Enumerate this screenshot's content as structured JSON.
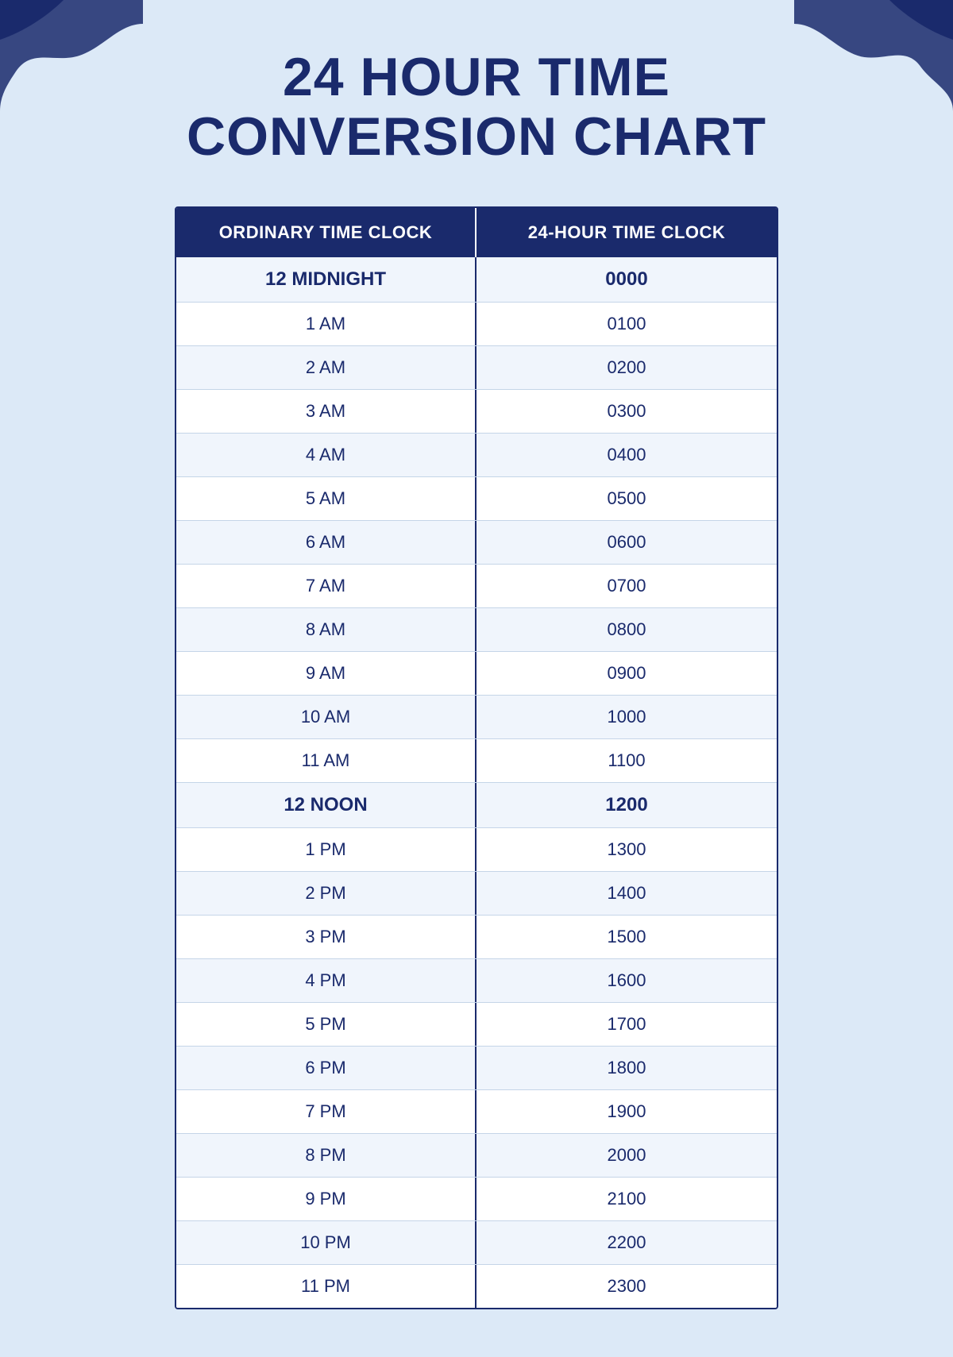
{
  "page": {
    "background_color": "#dce9f7",
    "title_line1": "24 HOUR TIME",
    "title_line2": "CONVERSION CHART"
  },
  "table": {
    "header": {
      "col1": "ORDINARY TIME CLOCK",
      "col2": "24-HOUR TIME CLOCK"
    },
    "rows": [
      {
        "ordinary": "12 MIDNIGHT",
        "military": "0000",
        "special": "midnight"
      },
      {
        "ordinary": "1 AM",
        "military": "0100",
        "special": ""
      },
      {
        "ordinary": "2 AM",
        "military": "0200",
        "special": ""
      },
      {
        "ordinary": "3 AM",
        "military": "0300",
        "special": ""
      },
      {
        "ordinary": "4 AM",
        "military": "0400",
        "special": ""
      },
      {
        "ordinary": "5 AM",
        "military": "0500",
        "special": ""
      },
      {
        "ordinary": "6 AM",
        "military": "0600",
        "special": ""
      },
      {
        "ordinary": "7 AM",
        "military": "0700",
        "special": ""
      },
      {
        "ordinary": "8 AM",
        "military": "0800",
        "special": ""
      },
      {
        "ordinary": "9 AM",
        "military": "0900",
        "special": ""
      },
      {
        "ordinary": "10 AM",
        "military": "1000",
        "special": ""
      },
      {
        "ordinary": "11 AM",
        "military": "1100",
        "special": ""
      },
      {
        "ordinary": "12 NOON",
        "military": "1200",
        "special": "noon"
      },
      {
        "ordinary": "1 PM",
        "military": "1300",
        "special": ""
      },
      {
        "ordinary": "2 PM",
        "military": "1400",
        "special": ""
      },
      {
        "ordinary": "3 PM",
        "military": "1500",
        "special": ""
      },
      {
        "ordinary": "4 PM",
        "military": "1600",
        "special": ""
      },
      {
        "ordinary": "5 PM",
        "military": "1700",
        "special": ""
      },
      {
        "ordinary": "6 PM",
        "military": "1800",
        "special": ""
      },
      {
        "ordinary": "7 PM",
        "military": "1900",
        "special": ""
      },
      {
        "ordinary": "8 PM",
        "military": "2000",
        "special": ""
      },
      {
        "ordinary": "9 PM",
        "military": "2100",
        "special": ""
      },
      {
        "ordinary": "10 PM",
        "military": "2200",
        "special": ""
      },
      {
        "ordinary": "11 PM",
        "military": "2300",
        "special": ""
      }
    ]
  }
}
